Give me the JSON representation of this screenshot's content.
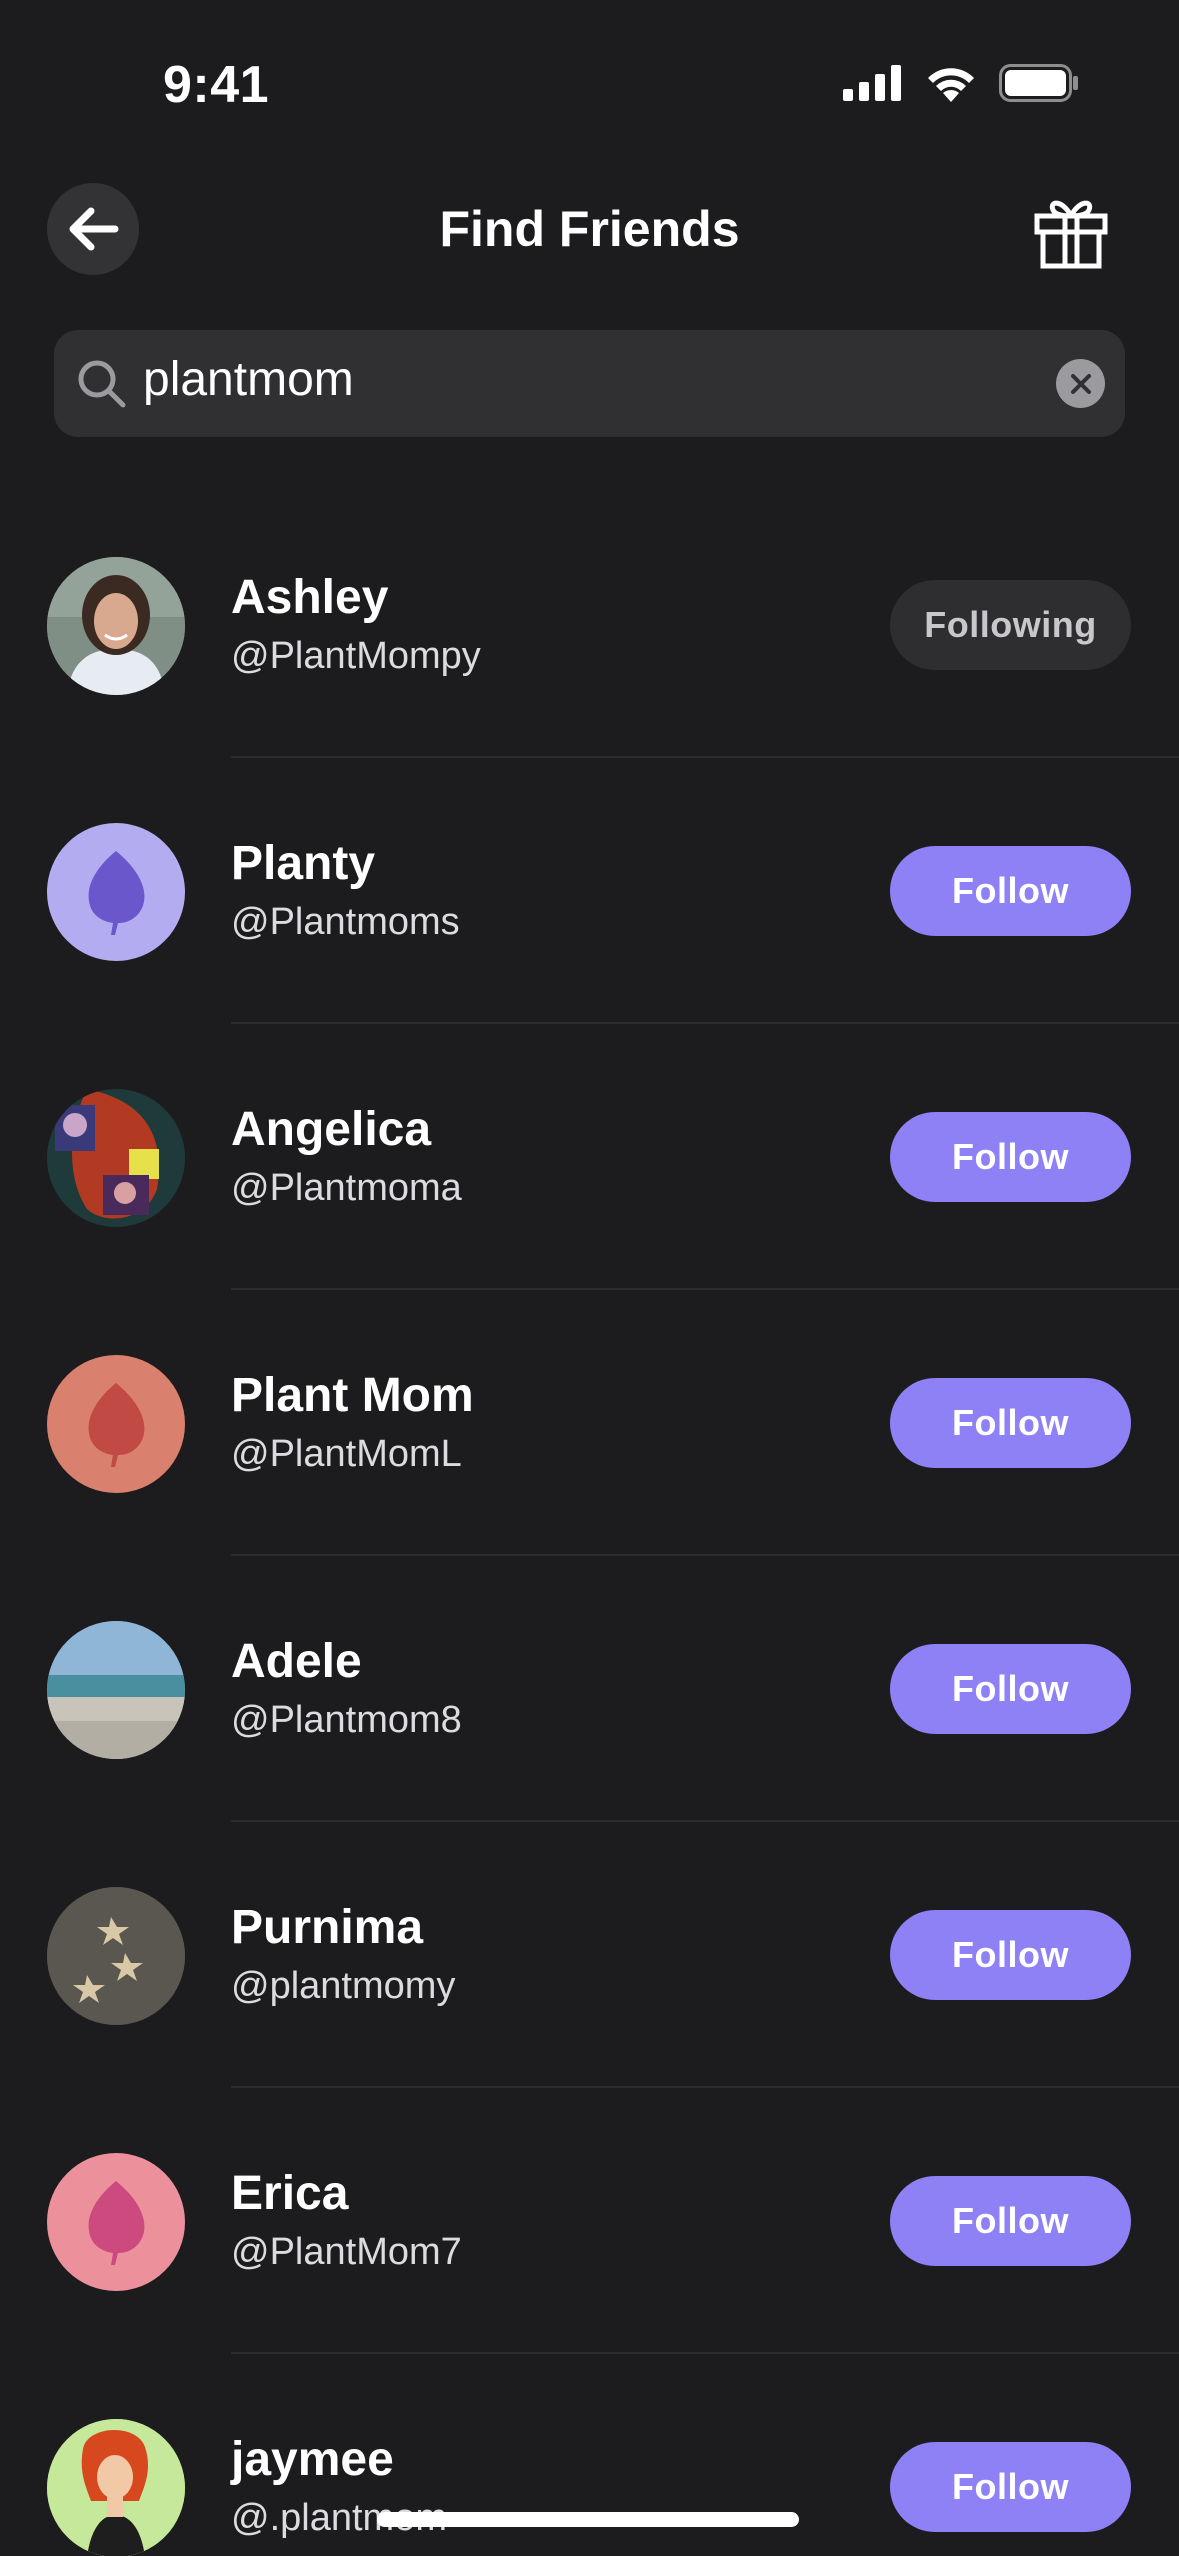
{
  "status_bar": {
    "time": "9:41"
  },
  "header": {
    "title": "Find Friends"
  },
  "search": {
    "value": "plantmom"
  },
  "users": [
    {
      "name": "Ashley",
      "handle": "@PlantMompy",
      "button": "Following",
      "state": "following",
      "avatar": "photo-portrait"
    },
    {
      "name": "Planty",
      "handle": "@Plantmoms",
      "button": "Follow",
      "state": "follow",
      "avatar": "leaf-icon",
      "avatar_bg": "#b3acf0",
      "leaf_color": "#6a57cc"
    },
    {
      "name": "Angelica",
      "handle": "@Plantmoma",
      "button": "Follow",
      "state": "follow",
      "avatar": "photo-collage"
    },
    {
      "name": "Plant Mom",
      "handle": "@PlantMomL",
      "button": "Follow",
      "state": "follow",
      "avatar": "leaf-icon",
      "avatar_bg": "#d9806e",
      "leaf_color": "#c24a45"
    },
    {
      "name": "Adele",
      "handle": "@Plantmom8",
      "button": "Follow",
      "state": "follow",
      "avatar": "photo-beach"
    },
    {
      "name": "Purnima",
      "handle": "@plantmomy",
      "button": "Follow",
      "state": "follow",
      "avatar": "photo-starfish"
    },
    {
      "name": "Erica",
      "handle": "@PlantMom7",
      "button": "Follow",
      "state": "follow",
      "avatar": "leaf-icon",
      "avatar_bg": "#ec909c",
      "leaf_color": "#cc4a7e"
    },
    {
      "name": "jaymee",
      "handle": "@.plantmom",
      "button": "Follow",
      "state": "follow",
      "avatar": "illustration-redhead"
    }
  ],
  "colors": {
    "background": "#1c1c1e",
    "accent": "#8e80f5",
    "following_button": "#2e2e31"
  }
}
